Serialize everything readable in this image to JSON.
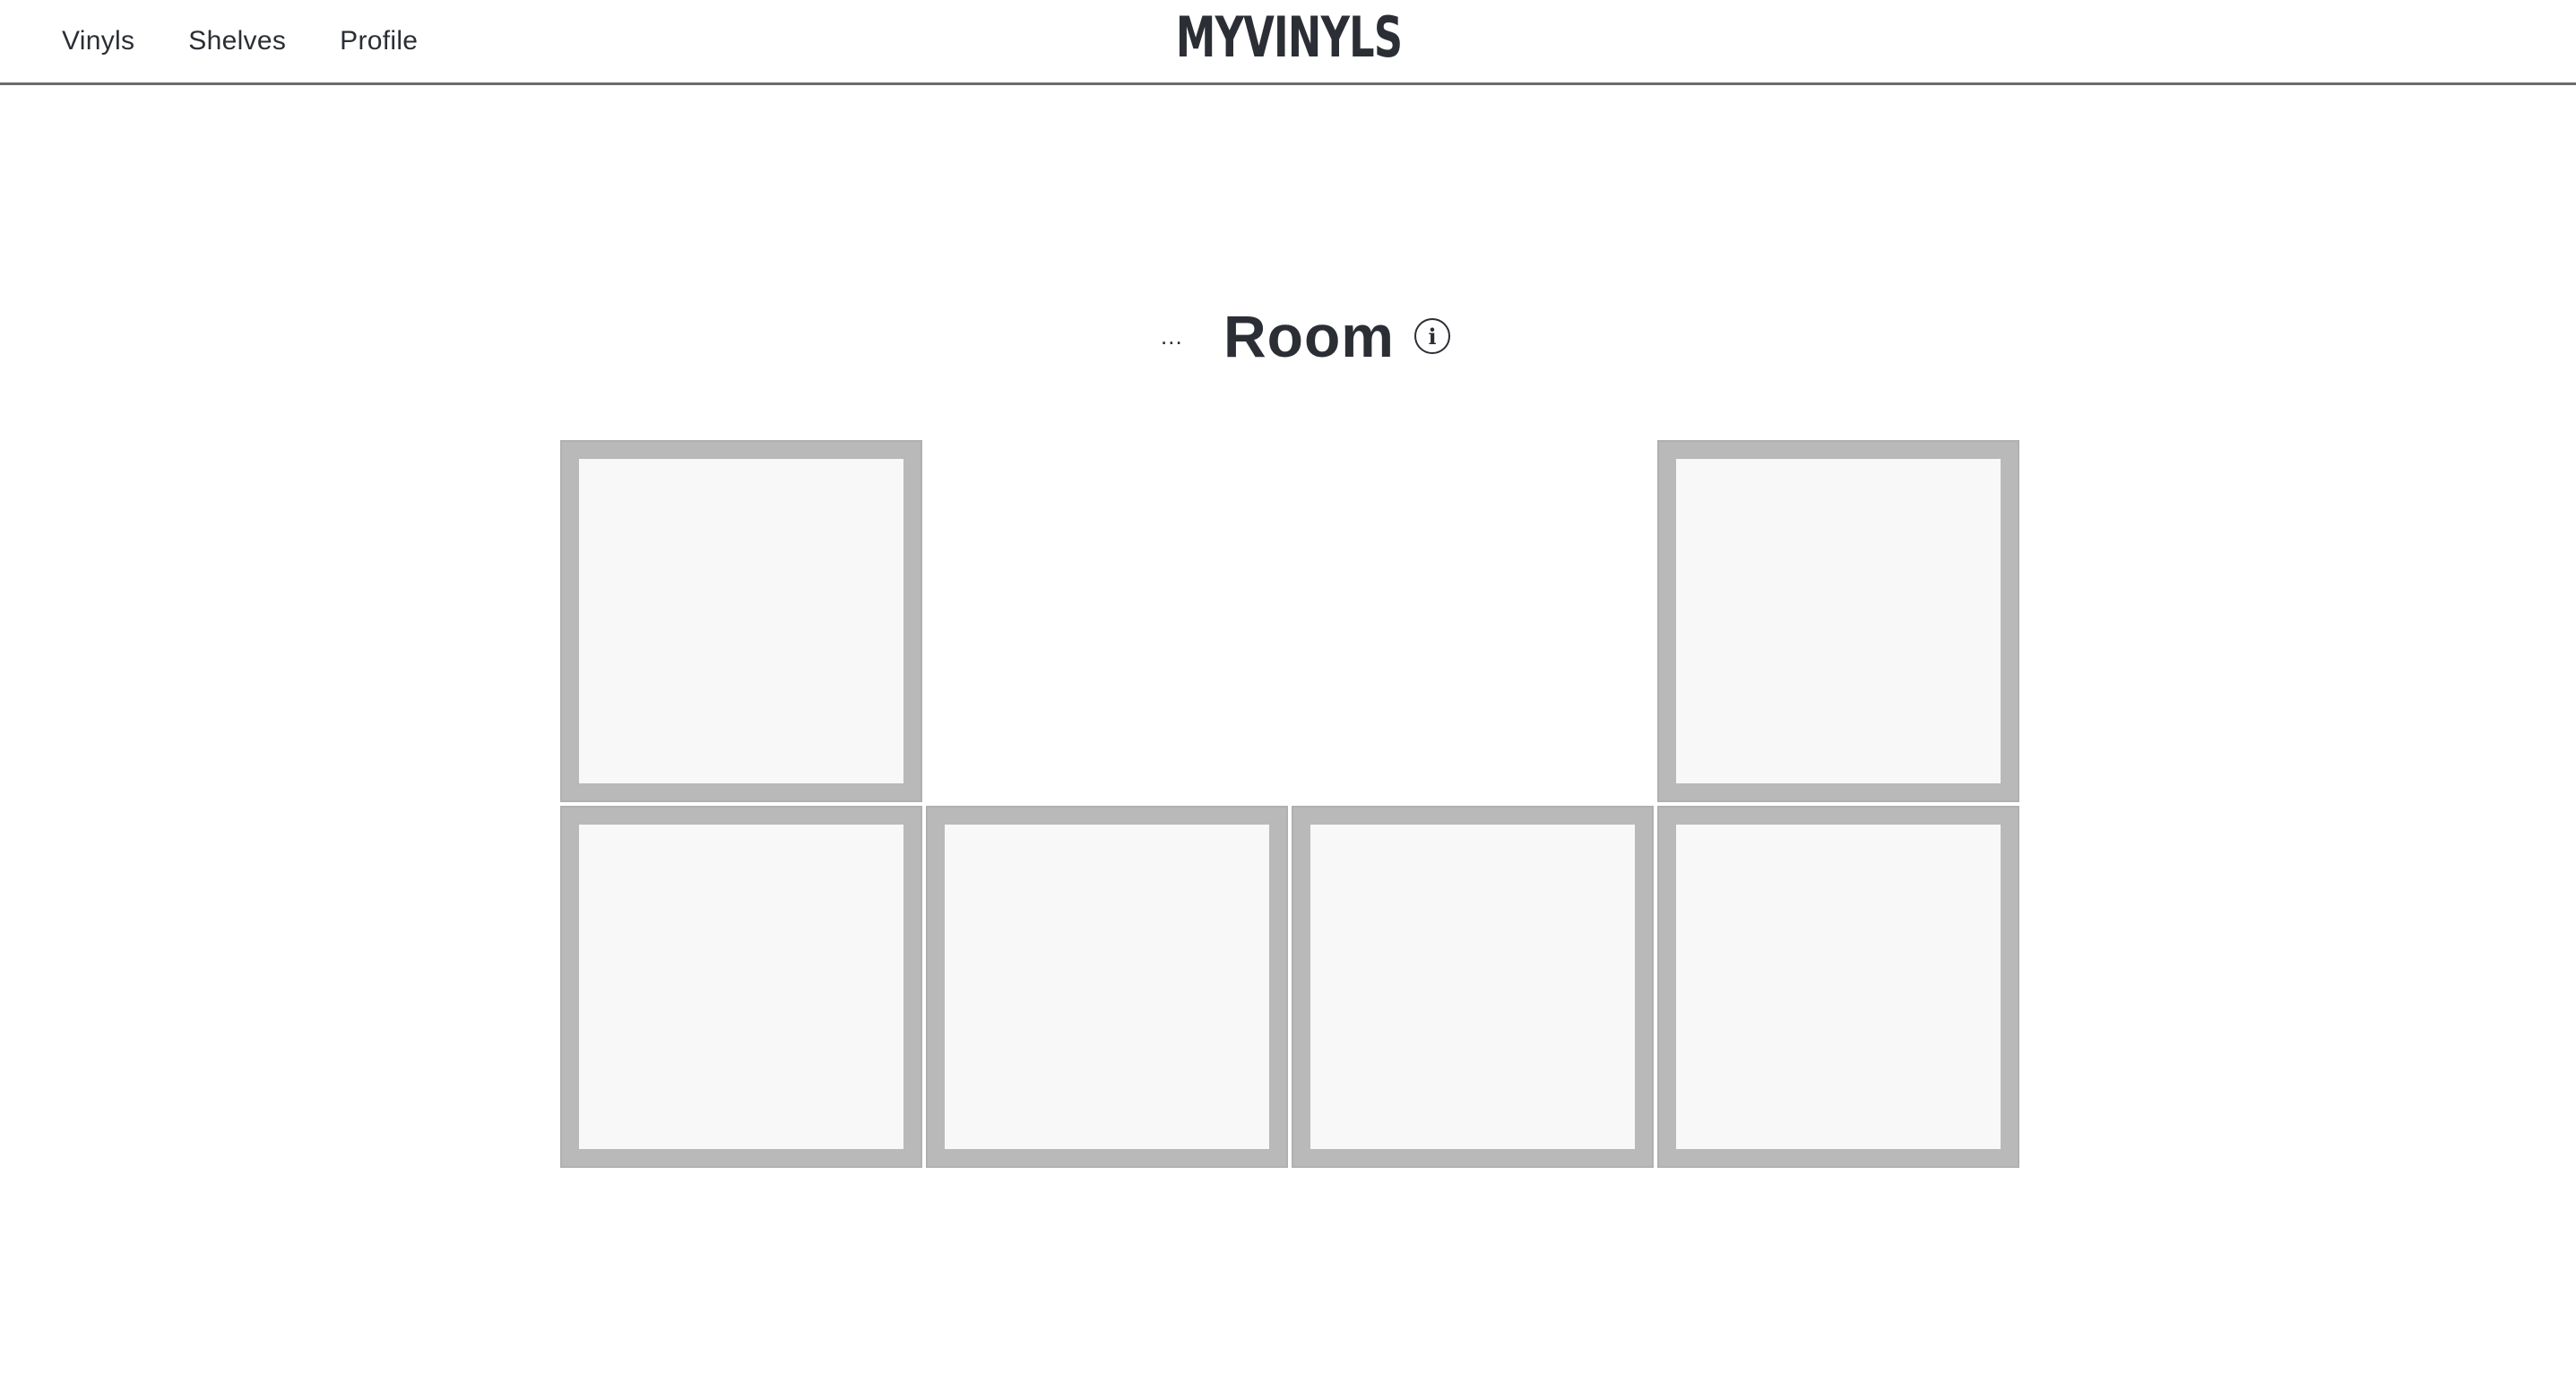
{
  "nav": {
    "links": [
      "Vinyls",
      "Shelves",
      "Profile"
    ],
    "brand": "MYVINYLS"
  },
  "room": {
    "more_label": "...",
    "title": "Room",
    "info_icon": "info-icon",
    "info_glyph": "i"
  },
  "shelf": {
    "columns": 4,
    "rows": 2,
    "occupied_cells": [
      {
        "row": 1,
        "col": 1
      },
      {
        "row": 1,
        "col": 4
      },
      {
        "row": 2,
        "col": 1
      },
      {
        "row": 2,
        "col": 2
      },
      {
        "row": 2,
        "col": 3
      },
      {
        "row": 2,
        "col": 4
      }
    ]
  },
  "colors": {
    "text": "#2b2e34",
    "cell_border": "#b9b9b9",
    "cell_fill": "#f8f8f8",
    "nav_divider": "#6b6b6b"
  }
}
